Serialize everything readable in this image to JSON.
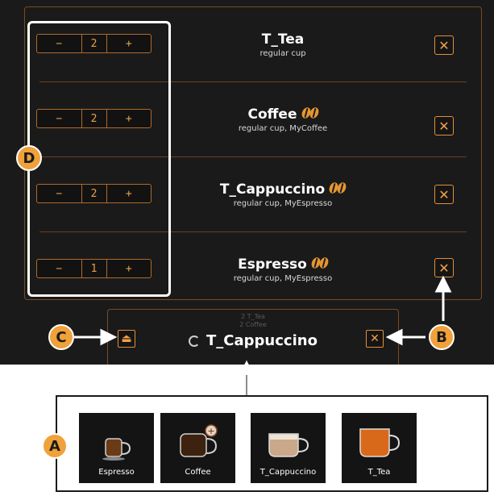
{
  "callouts": {
    "a": "A",
    "b": "B",
    "c": "C",
    "d": "D"
  },
  "orders": [
    {
      "name": "T_Tea",
      "detail": "regular cup",
      "qty": "2",
      "beans": false
    },
    {
      "name": "Coffee",
      "detail": "regular cup, MyCoffee",
      "qty": "2",
      "beans": true
    },
    {
      "name": "T_Cappuccino",
      "detail": "regular cup, MyEspresso",
      "qty": "2",
      "beans": true
    },
    {
      "name": "Espresso",
      "detail": "regular cup, MyEspresso",
      "qty": "1",
      "beans": true
    }
  ],
  "stepper": {
    "minus": "−",
    "plus": "+"
  },
  "delete_glyph": "✕",
  "status": {
    "queue": [
      "2 T_Tea",
      "2 Coffee"
    ],
    "current": "T_Cappuccino",
    "eject_glyph": "⏏",
    "cancel_glyph": "✕"
  },
  "favorites": [
    "Espresso",
    "Coffee",
    "T_Cappuccino",
    "T_Tea"
  ],
  "colors": {
    "accent": "#f0a13a",
    "border": "#b06a2a",
    "screen": "#1a1a1a"
  }
}
